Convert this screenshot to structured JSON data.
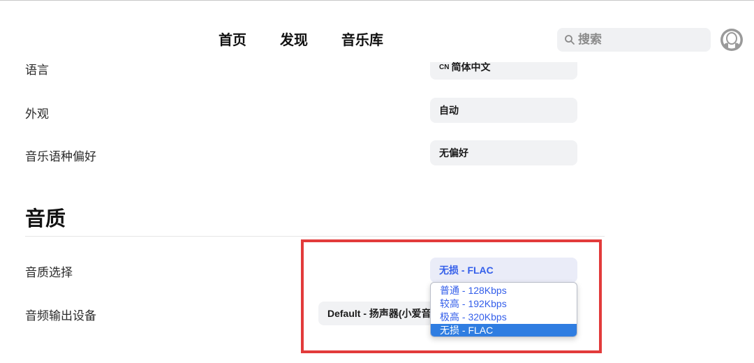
{
  "header": {
    "nav": [
      {
        "label": "首页"
      },
      {
        "label": "发现"
      },
      {
        "label": "音乐库"
      }
    ],
    "search": {
      "placeholder": "搜索"
    }
  },
  "settings": {
    "language": {
      "label": "语言",
      "badge": "CN",
      "value": "简体中文"
    },
    "appearance": {
      "label": "外观",
      "value": "自动"
    },
    "music_language": {
      "label": "音乐语种偏好",
      "value": "无偏好"
    }
  },
  "quality_section": {
    "title": "音质",
    "quality_label": "音质选择",
    "quality_value": "无损 - FLAC",
    "options": [
      {
        "label": "普通 - 128Kbps"
      },
      {
        "label": "较高 - 192Kbps"
      },
      {
        "label": "极高 - 320Kbps"
      },
      {
        "label": "无损 - FLAC"
      }
    ],
    "selected_index": 3,
    "output_label": "音频输出设备",
    "output_value": "Default - 扬声器(小爱音"
  },
  "colors": {
    "accent": "#335eea",
    "highlight_border": "#e23b3b",
    "selected_option_bg": "#2f7de1"
  }
}
